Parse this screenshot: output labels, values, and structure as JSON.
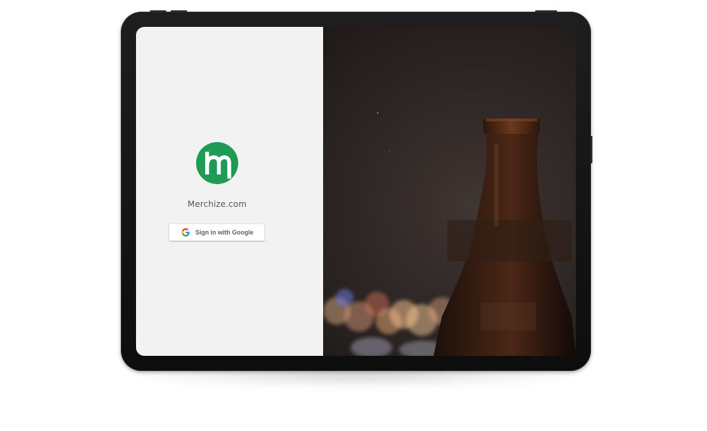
{
  "login": {
    "brand_name": "Merchize.com",
    "logo_icon": "merchize-logo-icon",
    "sign_in_button": {
      "label": "Sign in with Google",
      "icon": "google-icon"
    }
  },
  "hero": {
    "image_icon": "beer-bottle-bokeh-photo"
  },
  "colors": {
    "brand_green": "#1e9b55",
    "left_pane_bg": "#f2f2f2",
    "device_frame": "#111111",
    "button_text": "#5f5f5f"
  }
}
